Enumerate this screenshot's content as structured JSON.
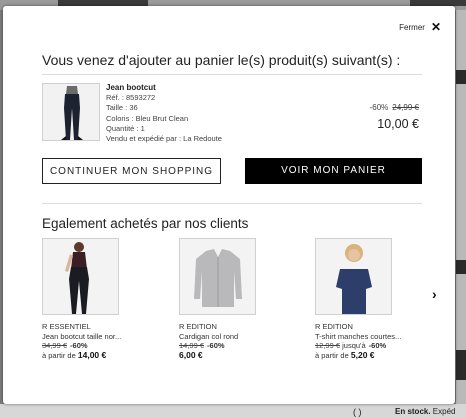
{
  "modal": {
    "close_label": "Fermer",
    "headline": "Vous venez d'ajouter au panier le(s) produit(s) suivant(s) :"
  },
  "product": {
    "name": "Jean bootcut",
    "ref": "Réf. : 8593272",
    "size": "Taille : 36",
    "color": "Coloris : Bleu Brut Clean",
    "quantity": "Quantité : 1",
    "seller": "Vendu et expédié par : La Redoute",
    "discount": "-60%",
    "old_price": "24,99 €",
    "new_price": "10,00 €"
  },
  "buttons": {
    "continue": "CONTINUER MON SHOPPING",
    "cart": "VOIR MON PANIER"
  },
  "reco": {
    "title": "Egalement achetés par nos clients",
    "items": [
      {
        "brand": "R ESSENTIEL",
        "name": "Jean bootcut taille nor...",
        "old_price": "34,99 €",
        "discount": "-60%",
        "from": "à partir de",
        "price": "14,00 €"
      },
      {
        "brand": "R EDITION",
        "name": "Cardigan col rond",
        "old_price": "14,99 €",
        "discount": "-60%",
        "from": "",
        "price": "6,00 €"
      },
      {
        "brand": "R EDITION",
        "name": "T-shirt manches courtes...",
        "old_price": "12,99 €",
        "discount": "-60%",
        "upto": "jusqu'à",
        "from": "à partir de",
        "price": "5,20 €"
      }
    ]
  },
  "background": {
    "paren": "( )",
    "stock_bold": "En stock.",
    "stock_rest": " Expéd"
  }
}
